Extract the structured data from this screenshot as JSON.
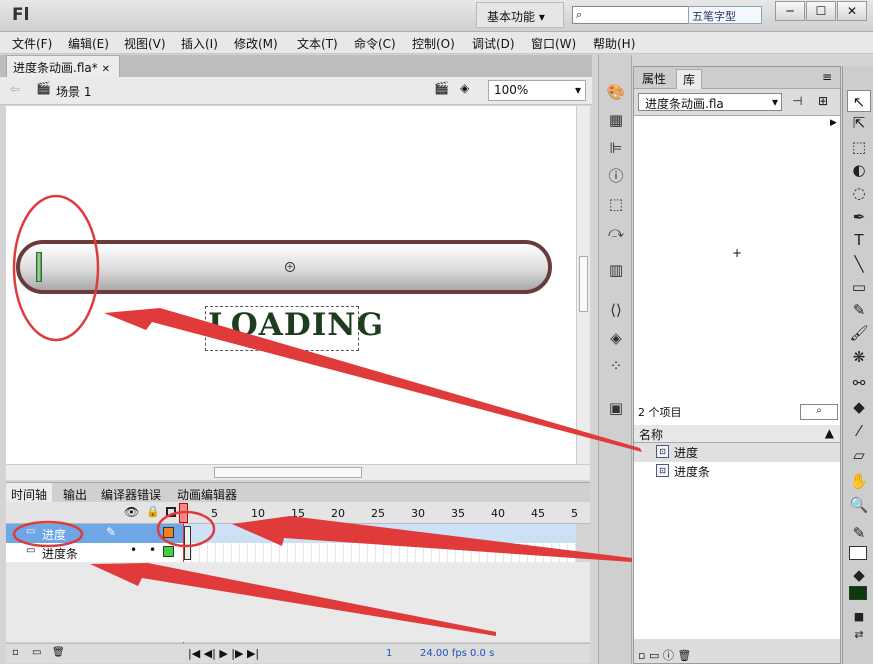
{
  "app": {
    "logo": "Fl",
    "workspace": "基本功能",
    "ime": "五笔字型",
    "window_buttons": [
      "─",
      "☐",
      "✕"
    ]
  },
  "menu": [
    "文件(F)",
    "编辑(E)",
    "视图(V)",
    "插入(I)",
    "修改(M)",
    "文本(T)",
    "命令(C)",
    "控制(O)",
    "调试(D)",
    "窗口(W)",
    "帮助(H)"
  ],
  "doc": {
    "tab_label": "进度条动画.fla*",
    "scene": "场景 1",
    "zoom": "100%"
  },
  "stage": {
    "loading_text": "LOADING",
    "bar_border_color": "#6b3a3a",
    "fill_color": "#7fbf7f",
    "progress_fraction": 0.01
  },
  "timeline": {
    "tabs": [
      "时间轴",
      "输出",
      "编译器错误",
      "动画编辑器"
    ],
    "frame_numbers": [
      "5",
      "10",
      "15",
      "20",
      "25",
      "30",
      "35",
      "40",
      "45",
      "5"
    ],
    "layers": [
      {
        "name": "进度"
      },
      {
        "name": "进度条"
      }
    ],
    "footer": {
      "frame": "1",
      "fps": "24.00 fps",
      "time": "0.0 s"
    }
  },
  "library": {
    "tabs": [
      "属性",
      "库"
    ],
    "file": "进度条动画.fla",
    "count": "2 个项目",
    "column_header": "名称",
    "items": [
      "进度",
      "进度条"
    ]
  },
  "annotation_color": "#e03a3a"
}
